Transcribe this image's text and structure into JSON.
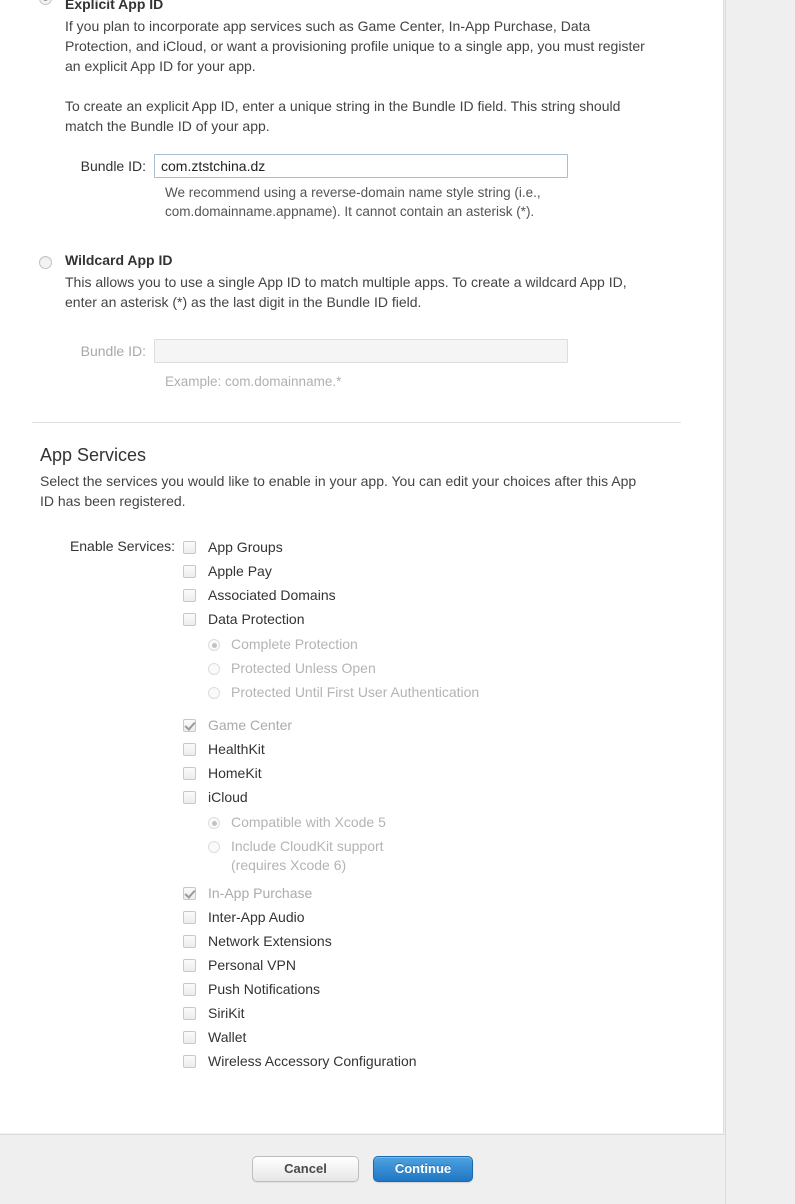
{
  "explicit": {
    "selected": true,
    "title": "Explicit App ID",
    "desc1": "If you plan to incorporate app services such as Game Center, In-App Purchase, Data Protection, and iCloud, or want a provisioning profile unique to a single app, you must register an explicit App ID for your app.",
    "desc2": "To create an explicit App ID, enter a unique string in the Bundle ID field. This string should match the Bundle ID of your app.",
    "bundle_label": "Bundle ID:",
    "bundle_value": "com.ztstchina.dz",
    "bundle_hint": "We recommend using a reverse-domain name style string (i.e., com.domainname.appname). It cannot contain an asterisk (*)."
  },
  "wildcard": {
    "selected": false,
    "title": "Wildcard App ID",
    "desc1": "This allows you to use a single App ID to match multiple apps. To create a wildcard App ID, enter an asterisk (*) as the last digit in the Bundle ID field.",
    "bundle_label": "Bundle ID:",
    "bundle_value": "",
    "bundle_placeholder": "",
    "bundle_hint": "Example: com.domainname.*"
  },
  "app_services": {
    "title": "App Services",
    "desc": "Select the services you would like to enable in your app. You can edit your choices after this App ID has been registered.",
    "enable_label": "Enable Services:",
    "items": [
      {
        "label": "App Groups",
        "checked": false,
        "disabled": false
      },
      {
        "label": "Apple Pay",
        "checked": false,
        "disabled": false
      },
      {
        "label": "Associated Domains",
        "checked": false,
        "disabled": false
      },
      {
        "label": "Data Protection",
        "checked": false,
        "disabled": false
      }
    ],
    "data_protection_options": [
      {
        "label": "Complete Protection",
        "selected": true,
        "disabled": true
      },
      {
        "label": "Protected Unless Open",
        "selected": false,
        "disabled": true
      },
      {
        "label": "Protected Until First User Authentication",
        "selected": false,
        "disabled": true
      }
    ],
    "items2": [
      {
        "label": "Game Center",
        "checked": true,
        "disabled": true
      },
      {
        "label": "HealthKit",
        "checked": false,
        "disabled": false
      },
      {
        "label": "HomeKit",
        "checked": false,
        "disabled": false
      },
      {
        "label": "iCloud",
        "checked": false,
        "disabled": false
      }
    ],
    "icloud_options": [
      {
        "label": "Compatible with Xcode 5",
        "label2": "",
        "selected": true,
        "disabled": true
      },
      {
        "label": "Include CloudKit support",
        "label2": "(requires Xcode 6)",
        "selected": false,
        "disabled": true
      }
    ],
    "items3": [
      {
        "label": "In-App Purchase",
        "checked": true,
        "disabled": true
      },
      {
        "label": "Inter-App Audio",
        "checked": false,
        "disabled": false
      },
      {
        "label": "Network Extensions",
        "checked": false,
        "disabled": false
      },
      {
        "label": "Personal VPN",
        "checked": false,
        "disabled": false
      },
      {
        "label": "Push Notifications",
        "checked": false,
        "disabled": false
      },
      {
        "label": "SiriKit",
        "checked": false,
        "disabled": false
      },
      {
        "label": "Wallet",
        "checked": false,
        "disabled": false
      },
      {
        "label": "Wireless Accessory Configuration",
        "checked": false,
        "disabled": false
      }
    ]
  },
  "footer": {
    "cancel_label": "Cancel",
    "continue_label": "Continue"
  },
  "colors": {
    "accent": "#1f77c4",
    "panel_bg": "#ffffff",
    "page_bg": "#efefef",
    "text": "#333333",
    "muted_text": "#b4b4b4"
  }
}
